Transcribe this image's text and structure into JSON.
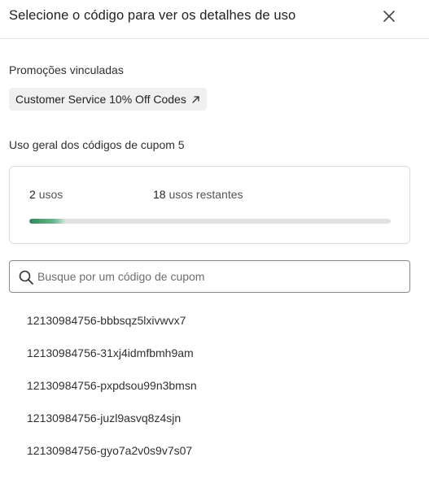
{
  "header": {
    "title": "Selecione o código para ver os detalhes de uso",
    "close_icon": "close-icon"
  },
  "promotions": {
    "label": "Promoções vinculadas",
    "chip_label": "Customer Service 10% Off Codes",
    "chip_icon": "external-link-arrow-icon"
  },
  "usage": {
    "label": "Uso geral dos códigos de cupom 5",
    "used_count": "2",
    "used_text": "usos",
    "remaining_count": "18",
    "remaining_text": "usos restantes",
    "progress_fraction": 0.1,
    "accent_color": "#2a8a5a"
  },
  "search": {
    "placeholder": "Busque por um código de cupom",
    "value": "",
    "icon": "search-icon"
  },
  "codes": [
    "12130984756-bbbsqz5lxivwvx7",
    "12130984756-31xj4idmfbmh9am",
    "12130984756-pxpdsou99n3bmsn",
    "12130984756-juzl9asvq8z4sjn",
    "12130984756-gyo7a2v0s9v7s07"
  ]
}
